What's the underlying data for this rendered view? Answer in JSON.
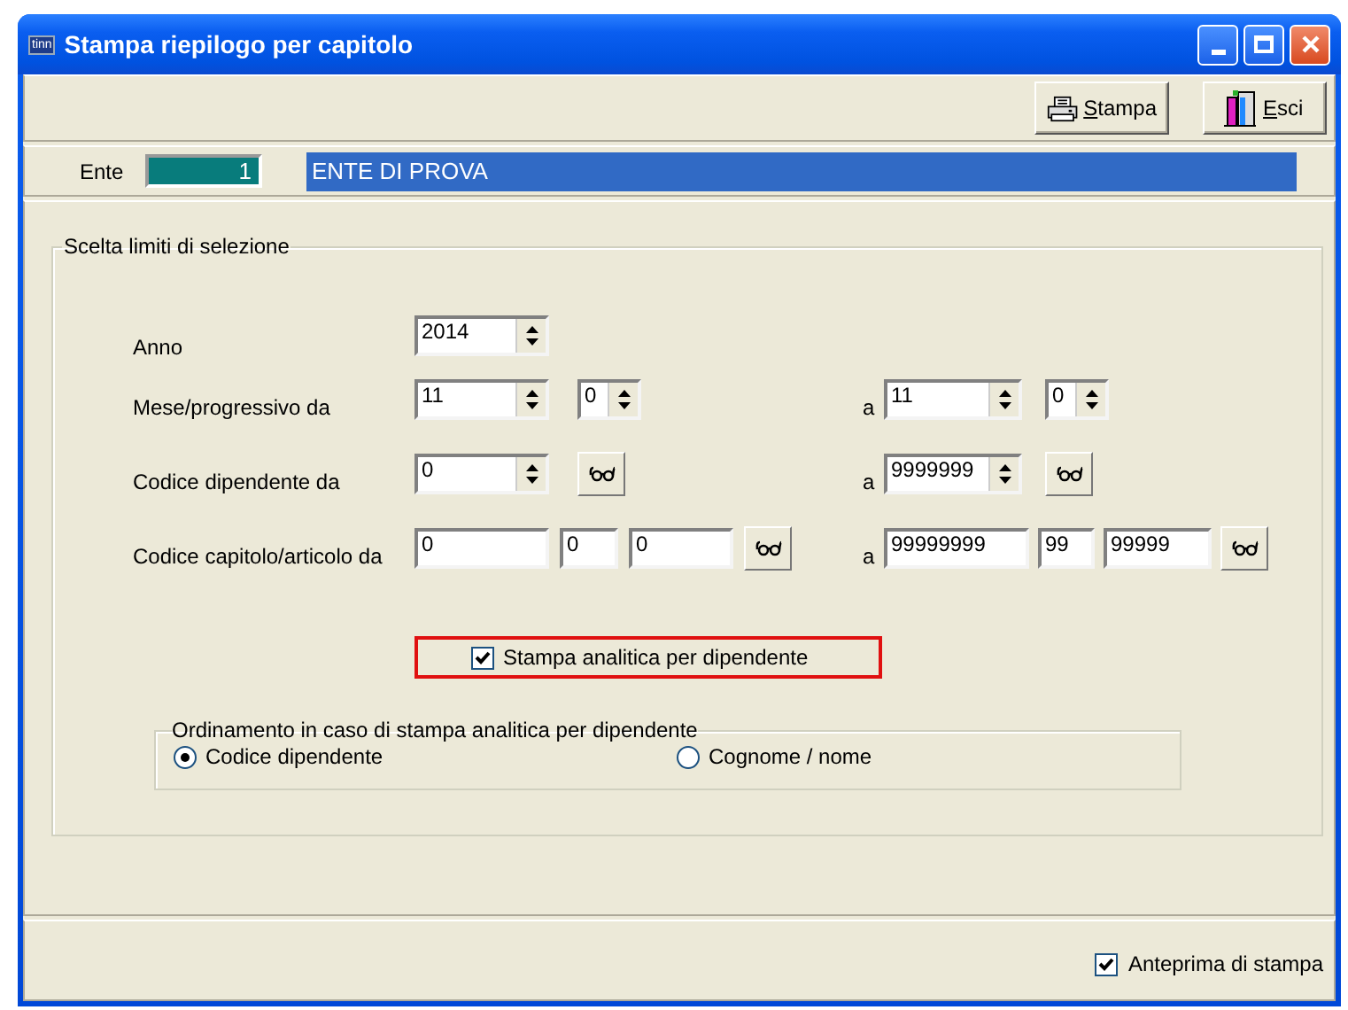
{
  "window": {
    "app_icon": "tinn",
    "title": "Stampa riepilogo per capitolo"
  },
  "toolbar": [
    {
      "label": "Stampa",
      "mnemonic_underlined": true,
      "kind": "print"
    },
    {
      "label": "Esci",
      "mnemonic_underlined": true,
      "kind": "exit"
    }
  ],
  "ente": {
    "label": "Ente",
    "code": "1",
    "name": "ENTE DI PROVA"
  },
  "selection": {
    "title": "Scelta limiti di selezione",
    "rows": [
      {
        "label": "Anno",
        "from": [
          {
            "kind": "spin",
            "value": "2014"
          }
        ]
      },
      {
        "label": "Mese/progressivo da",
        "from": [
          {
            "kind": "spin",
            "value": "11"
          },
          {
            "kind": "spin",
            "value": "0"
          }
        ],
        "to_label": "a",
        "to": [
          {
            "kind": "spin",
            "value": "11"
          },
          {
            "kind": "spin",
            "value": "0"
          }
        ]
      },
      {
        "label": "Codice dipendente da",
        "from": [
          {
            "kind": "spin",
            "value": "0"
          },
          {
            "kind": "lookup"
          }
        ],
        "to_label": "a",
        "to": [
          {
            "kind": "spin",
            "value": "9999999"
          },
          {
            "kind": "lookup"
          }
        ]
      },
      {
        "label": "Codice capitolo/articolo da",
        "from": [
          {
            "kind": "text",
            "value": "0"
          },
          {
            "kind": "text",
            "value": "0"
          },
          {
            "kind": "text",
            "value": "0"
          },
          {
            "kind": "lookup"
          }
        ],
        "to_label": "a",
        "to": [
          {
            "kind": "text",
            "value": "99999999"
          },
          {
            "kind": "text",
            "value": "99"
          },
          {
            "kind": "text",
            "value": "99999"
          },
          {
            "kind": "lookup"
          }
        ]
      }
    ],
    "analytic": {
      "label": "Stampa analitica per dipendente",
      "checked": true,
      "highlighted": true
    },
    "ordering": {
      "title": "Ordinamento in caso di stampa analitica per dipendente",
      "options": [
        {
          "label": "Codice dipendente",
          "selected": true
        },
        {
          "label": "Cognome / nome",
          "selected": false
        }
      ]
    }
  },
  "footer": {
    "preview": {
      "label": "Anteprima di stampa",
      "checked": true
    }
  }
}
